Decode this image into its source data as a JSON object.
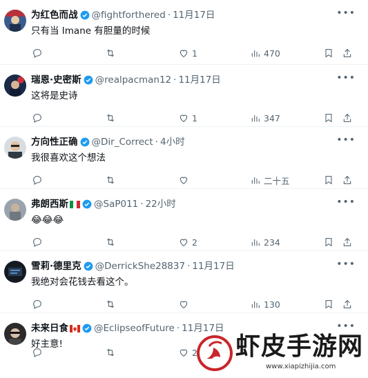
{
  "colors": {
    "text": "#0f1419",
    "muted": "#536471",
    "verified": "#1d9bf0",
    "watermark": "#c8262b"
  },
  "tweets": [
    {
      "name": "为红色而战",
      "flag": "",
      "handle": "@fightforthered",
      "time": "11月17日",
      "text": "只有当 Imane 有胆量的时候",
      "reply": "",
      "retweet": "",
      "like": "1",
      "views": "470"
    },
    {
      "name": "瑞恩·史密斯",
      "flag": "",
      "handle": "@realpacman12",
      "time": "11月17日",
      "text": "这将是史诗",
      "reply": "",
      "retweet": "",
      "like": "1",
      "views": "347"
    },
    {
      "name": "方向性正确",
      "flag": "",
      "handle": "@Dir_Correct",
      "time": "4小时",
      "text": "我很喜欢这个想法",
      "reply": "",
      "retweet": "",
      "like": "",
      "views": "二十五"
    },
    {
      "name": "弗朗西斯",
      "flag": "italy-flag",
      "handle": "@SaP011",
      "time": "22小时",
      "text": "😂😂😂",
      "reply": "",
      "retweet": "",
      "like": "2",
      "views": "234"
    },
    {
      "name": "雪莉·德里克",
      "flag": "",
      "handle": "@DerrickShe28837",
      "time": "11月17日",
      "text": "我绝对会花钱去看这个。",
      "reply": "",
      "retweet": "",
      "like": "",
      "views": "130"
    },
    {
      "name": "未来日食",
      "flag": "canada-flag",
      "handle": "@EclipseofFuture",
      "time": "11月17日",
      "text": "好主意!",
      "reply": "",
      "retweet": "",
      "like": "2",
      "views": ""
    }
  ],
  "watermark": {
    "brand": "虾皮手游网",
    "url": "www.xiapizhijia.com"
  }
}
